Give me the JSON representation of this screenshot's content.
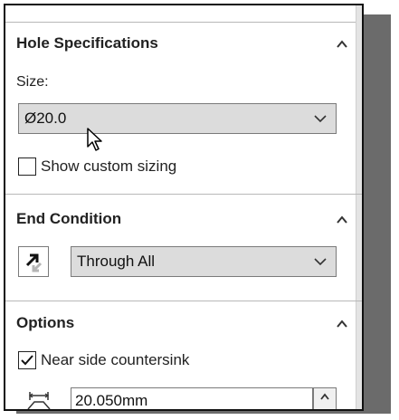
{
  "hole_specifications": {
    "title": "Hole Specifications",
    "size_label": "Size:",
    "size_value": "Ø20.0",
    "show_custom_sizing_label": "Show custom sizing",
    "show_custom_sizing_checked": false
  },
  "end_condition": {
    "title": "End Condition",
    "value": "Through All"
  },
  "options": {
    "title": "Options",
    "near_side_countersink_label": "Near side countersink",
    "near_side_countersink_checked": true,
    "countersink_diameter_value": "20.050mm"
  },
  "icons": {
    "collapse": "chevron-up-icon",
    "dropdown": "chevron-down-icon",
    "reverse_direction": "reverse-direction-icon",
    "diameter": "countersink-diameter-icon",
    "cursor": "mouse-pointer-icon"
  }
}
